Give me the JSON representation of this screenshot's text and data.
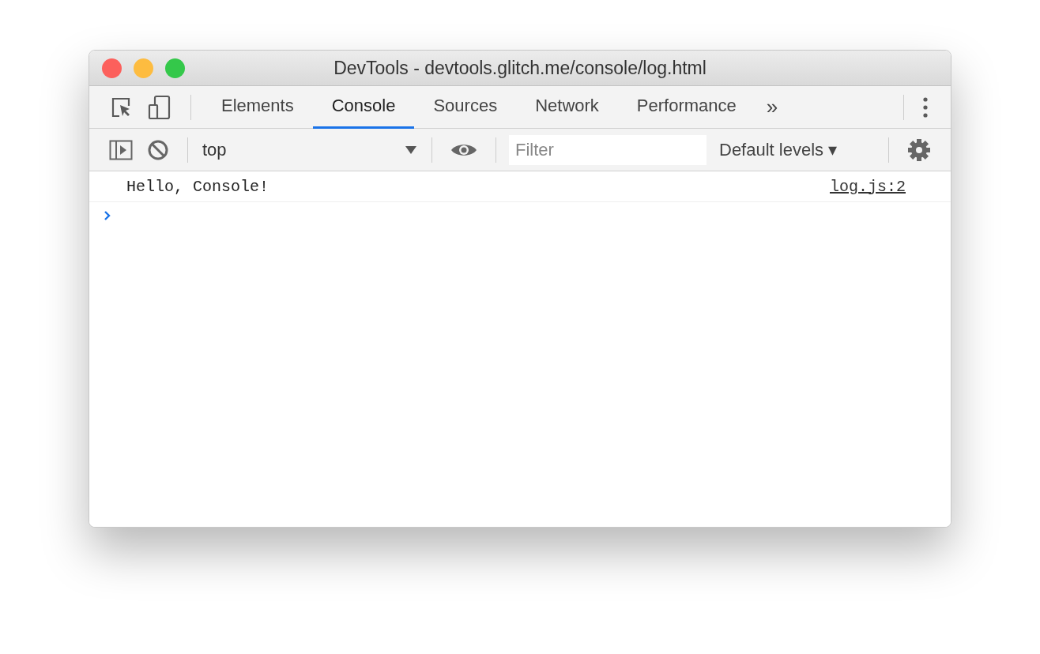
{
  "window": {
    "title": "DevTools - devtools.glitch.me/console/log.html"
  },
  "tabs": [
    {
      "label": "Elements",
      "selected": false
    },
    {
      "label": "Console",
      "selected": true
    },
    {
      "label": "Sources",
      "selected": false
    },
    {
      "label": "Network",
      "selected": false
    },
    {
      "label": "Performance",
      "selected": false
    }
  ],
  "more_tabs": "»",
  "toolbar": {
    "context": "top",
    "filter": {
      "placeholder": "Filter"
    },
    "levels": "Default levels ▾"
  },
  "messages": [
    {
      "text": "Hello, Console!",
      "source": "log.js:2"
    }
  ]
}
